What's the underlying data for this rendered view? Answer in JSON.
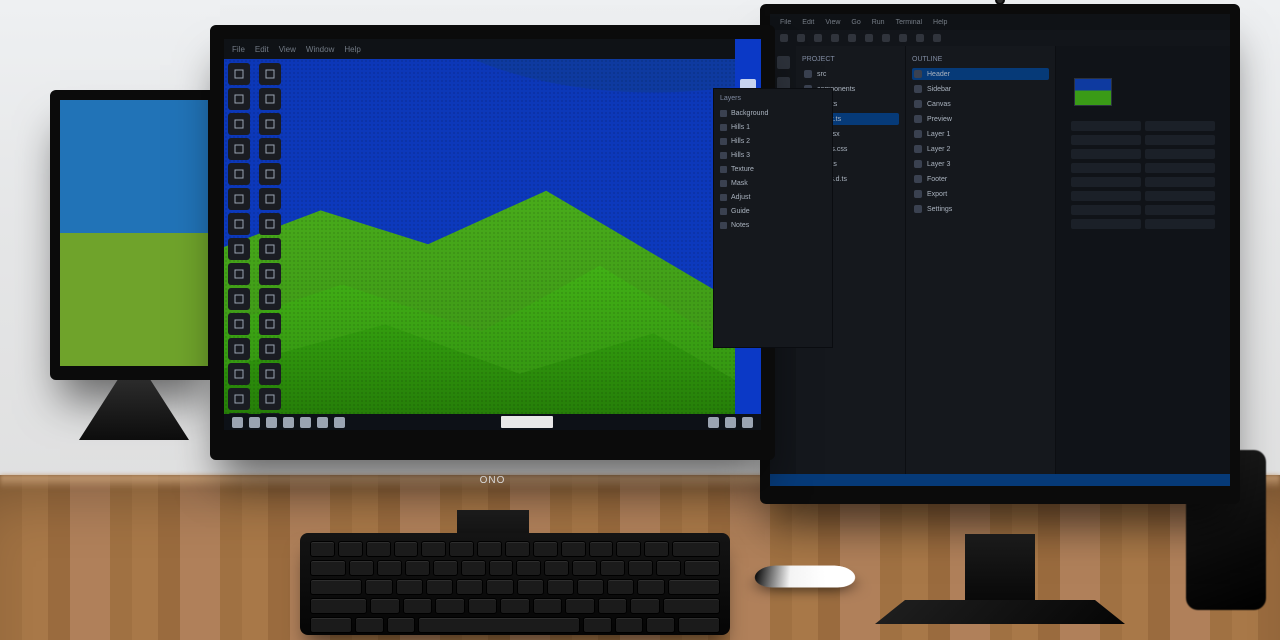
{
  "scene": {
    "description": "Photograph of a triple-monitor desk setup",
    "monitor_logo": "ONO"
  },
  "center_monitor": {
    "titlebar_items": [
      "File",
      "Edit",
      "View",
      "Window",
      "Help"
    ],
    "toolbox_icons": [
      "move",
      "select",
      "lasso",
      "crop",
      "eyedrop",
      "brush",
      "eraser",
      "fill",
      "grad",
      "text",
      "shape",
      "hand",
      "zoom",
      "clone",
      "heal",
      "pen",
      "path",
      "mask",
      "dodge",
      "burn",
      "blur",
      "sharpen",
      "smudge",
      "swap",
      "fg",
      "bg",
      "rect",
      "ellipse",
      "line",
      "note"
    ],
    "pinned_icons": [
      "app1",
      "app2",
      "app3",
      "app4",
      "app5",
      "app6",
      "app7",
      "app8"
    ],
    "taskbar_icons": [
      "start",
      "search",
      "tasks",
      "explorer",
      "store",
      "mail",
      "edge"
    ]
  },
  "right_monitor": {
    "menubar": [
      "File",
      "Edit",
      "View",
      "Go",
      "Run",
      "Terminal",
      "Help"
    ],
    "activity_icons": [
      "files",
      "search",
      "scm",
      "debug",
      "ext",
      "remote"
    ],
    "panel1": {
      "header": "Project",
      "rows": [
        "src",
        "components",
        "assets",
        "index.ts",
        "app.tsx",
        "styles.css",
        "utils.ts",
        "types.d.ts"
      ]
    },
    "panel2": {
      "header": "Outline",
      "rows": [
        "Header",
        "Sidebar",
        "Canvas",
        "Preview",
        "Layer 1",
        "Layer 2",
        "Layer 3",
        "Footer",
        "Export",
        "Settings"
      ]
    }
  },
  "overlay_panel": {
    "header": "Layers",
    "rows": [
      "Background",
      "Hills 1",
      "Hills 2",
      "Hills 3",
      "Texture",
      "Mask",
      "Adjust",
      "Guide",
      "Notes"
    ]
  }
}
